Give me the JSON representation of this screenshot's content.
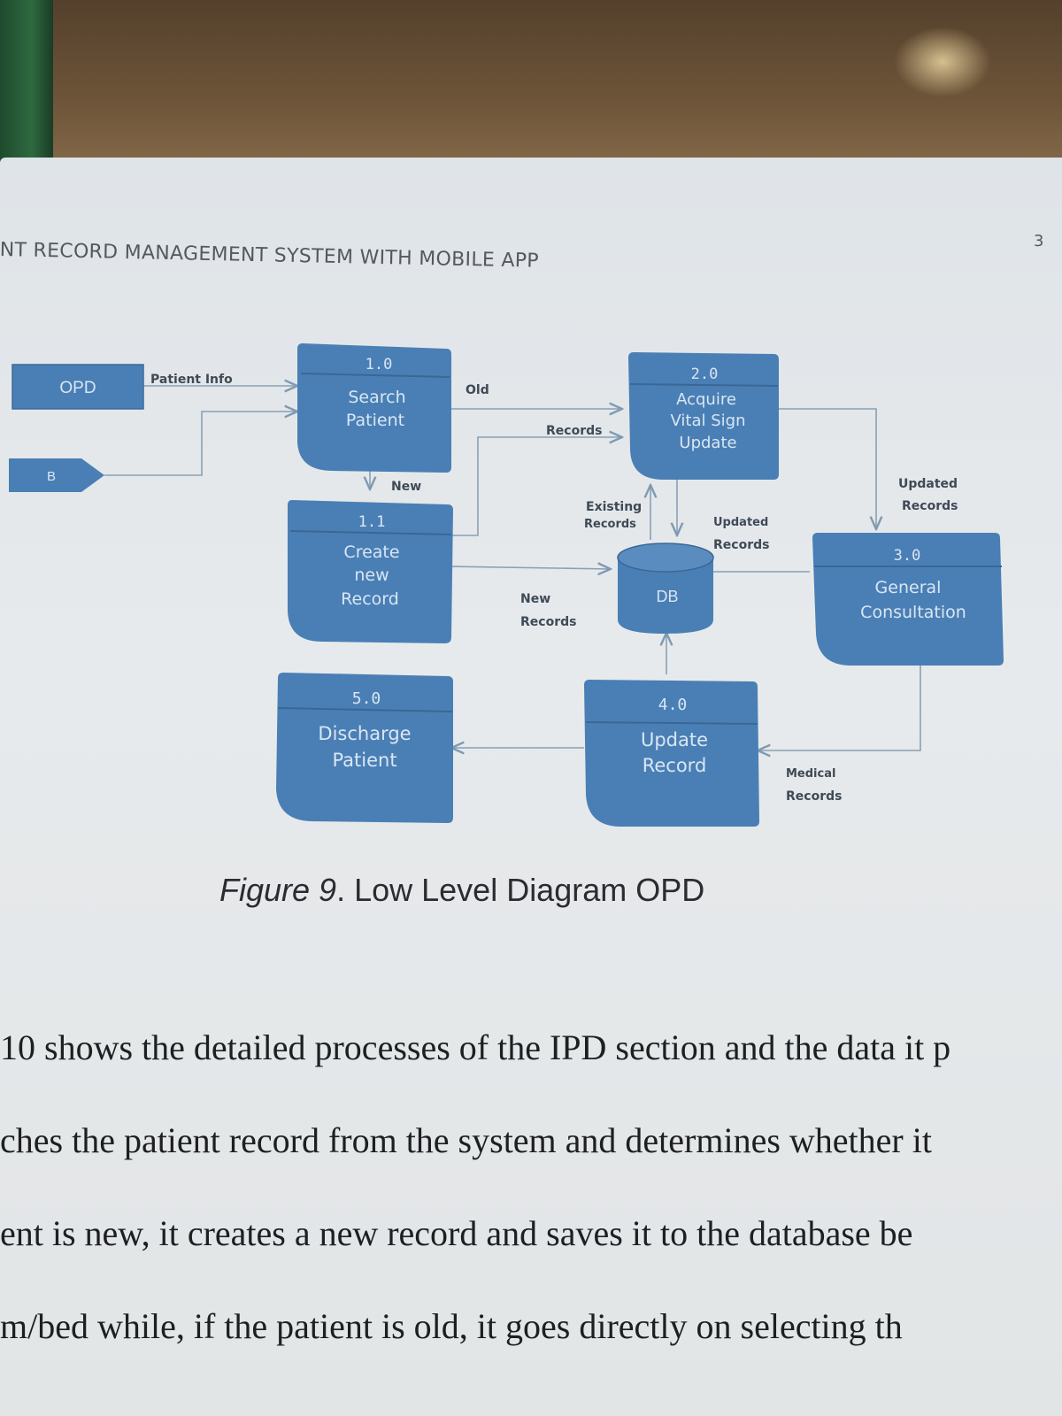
{
  "header": {
    "running_title": "NT RECORD MANAGEMENT SYSTEM WITH MOBILE APP",
    "page_number": "3"
  },
  "diagram": {
    "entities": {
      "opd": "OPD",
      "b": "B"
    },
    "processes": {
      "p1": {
        "num": "1.0",
        "line1": "Search",
        "line2": "Patient"
      },
      "p11": {
        "num": "1.1",
        "line1": "Create",
        "line2": "new",
        "line3": "Record"
      },
      "p2": {
        "num": "2.0",
        "line1": "Acquire",
        "line2": "Vital Sign",
        "line3": "Update"
      },
      "p3": {
        "num": "3.0",
        "line1": "General",
        "line2": "Consultation"
      },
      "p4": {
        "num": "4.0",
        "line1": "Update",
        "line2": "Record"
      },
      "p5": {
        "num": "5.0",
        "line1": "Discharge",
        "line2": "Patient"
      }
    },
    "datastore": {
      "label": "DB"
    },
    "flows": {
      "patient_info": "Patient Info",
      "old": "Old",
      "records": "Records",
      "new": "New",
      "existing_1": "Existing",
      "existing_2": "Records",
      "updated_1": "Updated",
      "updated_2": "Records",
      "new_records_1": "New",
      "new_records_2": "Records",
      "updated_right_1": "Updated",
      "updated_right_2": "Records",
      "medical_1": "Medical",
      "medical_2": "Records"
    }
  },
  "caption": {
    "figure": "Figure 9",
    "text": ". Low Level Diagram OPD"
  },
  "body_text": [
    "10 shows the detailed processes of the IPD section and the data it p",
    "ches the patient record from the system and determines whether it",
    "ent is new, it creates a new record and saves it to the database be",
    "m/bed while, if the patient is old, it goes directly on selecting th"
  ],
  "colors": {
    "box_fill": "#4a7fb5",
    "box_text": "#d9e6f3",
    "line": "#7f9ab2"
  }
}
